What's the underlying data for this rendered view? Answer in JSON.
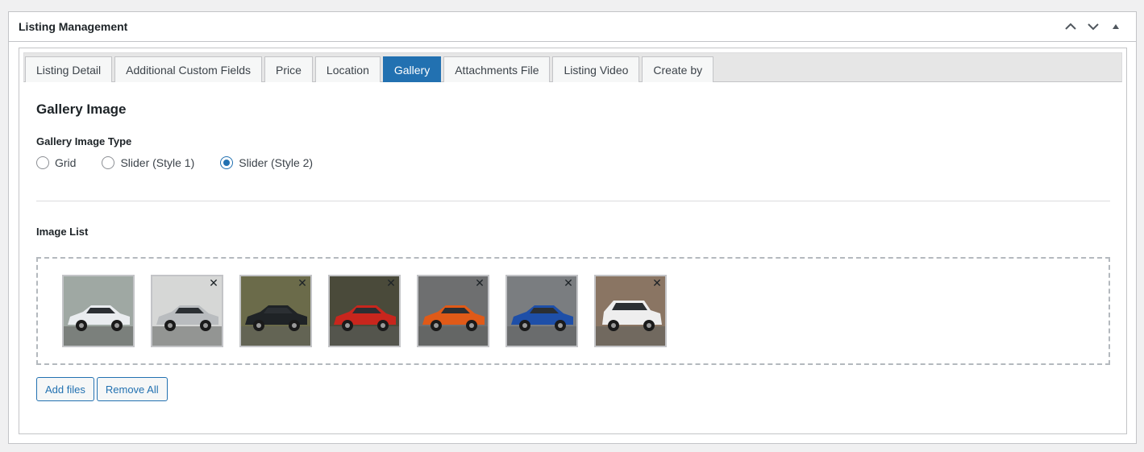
{
  "box": {
    "title": "Listing Management",
    "controls": [
      "chevron-up-icon",
      "chevron-down-icon",
      "triangle-up-icon"
    ]
  },
  "tabs": [
    {
      "label": "Listing Detail",
      "active": false
    },
    {
      "label": "Additional Custom Fields",
      "active": false
    },
    {
      "label": "Price",
      "active": false
    },
    {
      "label": "Location",
      "active": false
    },
    {
      "label": "Gallery",
      "active": true
    },
    {
      "label": "Attachments File",
      "active": false
    },
    {
      "label": "Listing Video",
      "active": false
    },
    {
      "label": "Create by",
      "active": false
    }
  ],
  "gallery": {
    "title": "Gallery Image",
    "type_label": "Gallery Image Type",
    "options": [
      {
        "label": "Grid",
        "checked": false
      },
      {
        "label": "Slider (Style 1)",
        "checked": false
      },
      {
        "label": "Slider (Style 2)",
        "checked": true
      }
    ],
    "image_list_label": "Image List",
    "images": [
      {
        "car": "white sedan",
        "color": "#e9ecef",
        "bg": "#9fa8a3"
      },
      {
        "car": "silver sports car",
        "color": "#b9bcbf",
        "bg": "#d6d7d6"
      },
      {
        "car": "black sedan",
        "color": "#1f2326",
        "bg": "#6b6b4a"
      },
      {
        "car": "red muscle car",
        "color": "#c8261d",
        "bg": "#4a4a3a"
      },
      {
        "car": "orange coupe",
        "color": "#e05a18",
        "bg": "#6e6f70"
      },
      {
        "car": "blue sedan",
        "color": "#1e4fa8",
        "bg": "#7a7d80"
      },
      {
        "car": "white suv",
        "color": "#eeeeee",
        "bg": "#8a7563"
      }
    ],
    "remove_symbol": "✕"
  },
  "buttons": {
    "add_files": "Add files",
    "remove_all": "Remove All"
  }
}
